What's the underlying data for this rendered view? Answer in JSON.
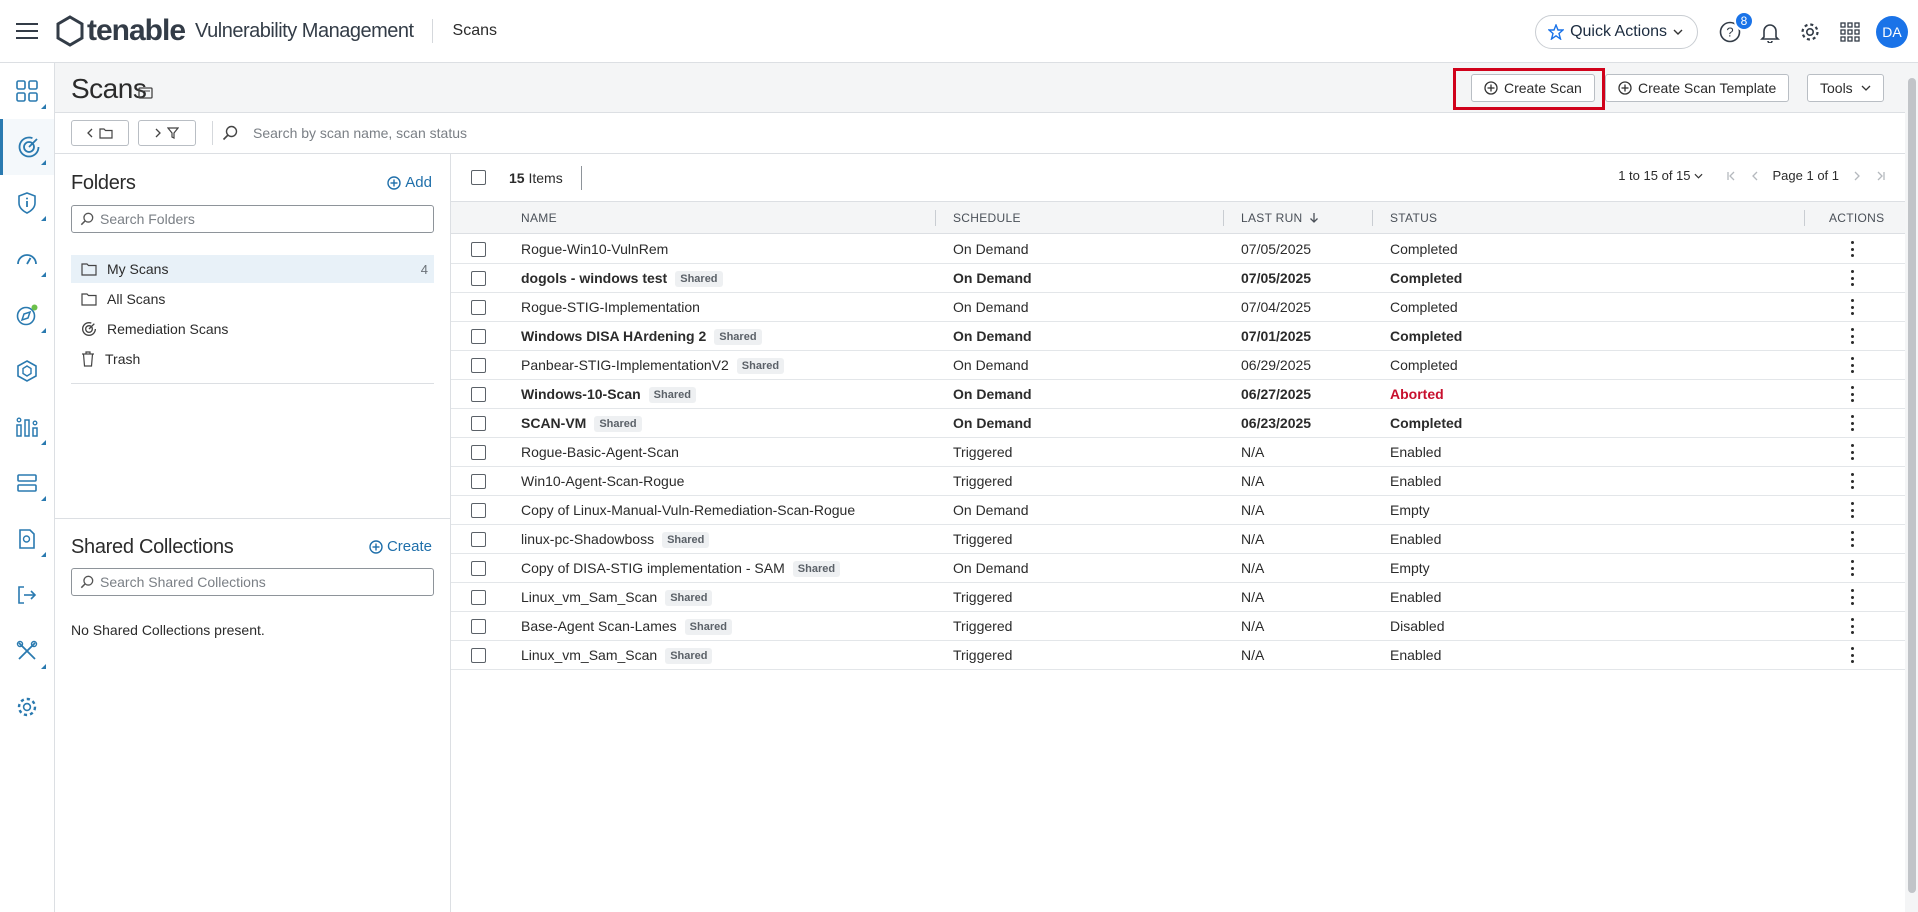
{
  "header": {
    "brand": "tenable",
    "product": "Vulnerability Management",
    "breadcrumb": "Scans",
    "quick_actions": "Quick Actions",
    "help_badge": "8",
    "avatar": "DA"
  },
  "nav": {
    "items": [
      {
        "name": "dashboard-icon"
      },
      {
        "name": "scans-icon",
        "active": true
      },
      {
        "name": "findings-icon"
      },
      {
        "name": "gauge-icon"
      },
      {
        "name": "explore-icon"
      },
      {
        "name": "assets-icon"
      },
      {
        "name": "reports-icon"
      },
      {
        "name": "server-icon"
      },
      {
        "name": "document-icon"
      },
      {
        "name": "export-icon"
      },
      {
        "name": "tools-icon"
      },
      {
        "name": "settings-icon"
      }
    ]
  },
  "page": {
    "title": "Scans",
    "create_scan": "Create Scan",
    "create_template": "Create Scan Template",
    "tools": "Tools",
    "search_placeholder": "Search by scan name, scan status"
  },
  "folders": {
    "title": "Folders",
    "add": "Add",
    "search_placeholder": "Search Folders",
    "items": [
      {
        "label": "My Scans",
        "count": "4",
        "icon": "folder-icon"
      },
      {
        "label": "All Scans",
        "count": "",
        "icon": "folder-icon"
      },
      {
        "label": "Remediation Scans",
        "count": "",
        "icon": "remediation-icon"
      },
      {
        "label": "Trash",
        "count": "",
        "icon": "trash-icon"
      }
    ]
  },
  "shared_collections": {
    "title": "Shared Collections",
    "create": "Create",
    "search_placeholder": "Search Shared Collections",
    "empty": "No Shared Collections present."
  },
  "table": {
    "count": "15",
    "count_label": "Items",
    "pager_range": "1 to 15 of 15",
    "pager_page": "Page 1 of 1",
    "columns": {
      "name": "NAME",
      "schedule": "SCHEDULE",
      "last_run": "LAST RUN",
      "status": "STATUS",
      "actions": "ACTIONS"
    },
    "shared_label": "Shared",
    "rows": [
      {
        "name": "Rogue-Win10-VulnRem",
        "shared": false,
        "schedule": "On Demand",
        "last_run": "07/05/2025",
        "status": "Completed",
        "bold": false
      },
      {
        "name": "dogols - windows test",
        "shared": true,
        "schedule": "On Demand",
        "last_run": "07/05/2025",
        "status": "Completed",
        "bold": true
      },
      {
        "name": "Rogue-STIG-Implementation",
        "shared": false,
        "schedule": "On Demand",
        "last_run": "07/04/2025",
        "status": "Completed",
        "bold": false
      },
      {
        "name": "Windows DISA HArdening 2",
        "shared": true,
        "schedule": "On Demand",
        "last_run": "07/01/2025",
        "status": "Completed",
        "bold": true
      },
      {
        "name": "Panbear-STIG-ImplementationV2",
        "shared": true,
        "schedule": "On Demand",
        "last_run": "06/29/2025",
        "status": "Completed",
        "bold": false
      },
      {
        "name": "Windows-10-Scan",
        "shared": true,
        "schedule": "On Demand",
        "last_run": "06/27/2025",
        "status": "Aborted",
        "bold": true
      },
      {
        "name": "SCAN-VM",
        "shared": true,
        "schedule": "On Demand",
        "last_run": "06/23/2025",
        "status": "Completed",
        "bold": true
      },
      {
        "name": "Rogue-Basic-Agent-Scan",
        "shared": false,
        "schedule": "Triggered",
        "last_run": "N/A",
        "status": "Enabled",
        "bold": false
      },
      {
        "name": "Win10-Agent-Scan-Rogue",
        "shared": false,
        "schedule": "Triggered",
        "last_run": "N/A",
        "status": "Enabled",
        "bold": false
      },
      {
        "name": "Copy of Linux-Manual-Vuln-Remediation-Scan-Rogue",
        "shared": false,
        "schedule": "On Demand",
        "last_run": "N/A",
        "status": "Empty",
        "bold": false
      },
      {
        "name": "linux-pc-Shadowboss",
        "shared": true,
        "schedule": "Triggered",
        "last_run": "N/A",
        "status": "Enabled",
        "bold": false
      },
      {
        "name": "Copy of DISA-STIG implementation - SAM",
        "shared": true,
        "schedule": "On Demand",
        "last_run": "N/A",
        "status": "Empty",
        "bold": false
      },
      {
        "name": "Linux_vm_Sam_Scan",
        "shared": true,
        "schedule": "Triggered",
        "last_run": "N/A",
        "status": "Enabled",
        "bold": false
      },
      {
        "name": "Base-Agent Scan-Lames",
        "shared": true,
        "schedule": "Triggered",
        "last_run": "N/A",
        "status": "Disabled",
        "bold": false
      },
      {
        "name": "Linux_vm_Sam_Scan",
        "shared": true,
        "schedule": "Triggered",
        "last_run": "N/A",
        "status": "Enabled",
        "bold": false
      }
    ]
  },
  "colors": {
    "accent": "#1a73e8",
    "link": "#1f6faa",
    "aborted": "#c8102e",
    "highlight": "#d0021b"
  }
}
